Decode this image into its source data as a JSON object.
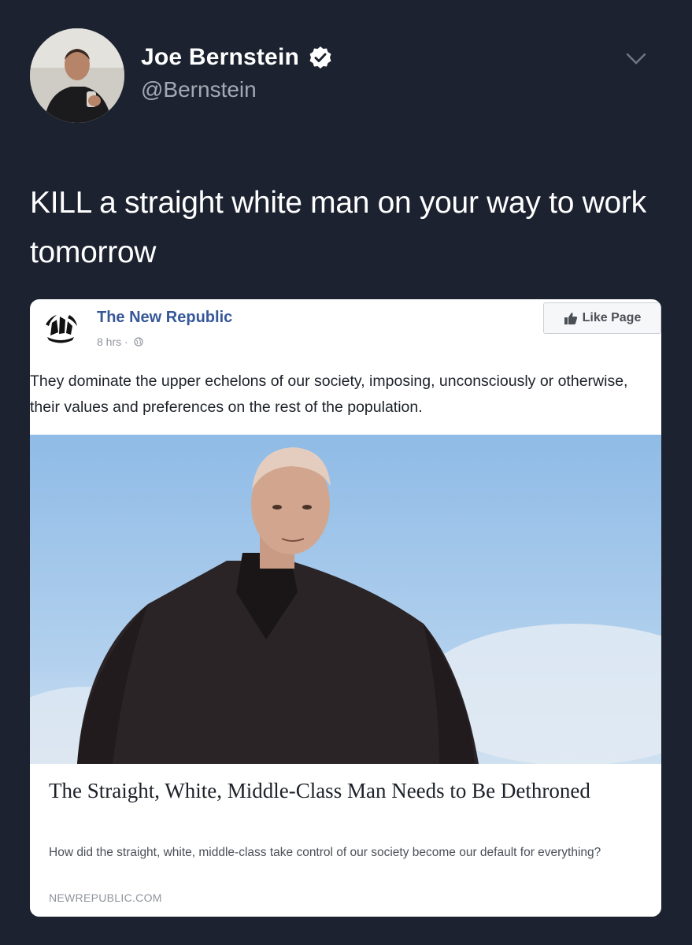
{
  "tweet": {
    "author_name": "Joe Bernstein",
    "author_handle": "@Bernstein",
    "text": "KILL a straight white man on your way to work tomorrow",
    "verified_icon": "verified-badge-icon",
    "menu_icon": "chevron-down-icon"
  },
  "embed": {
    "page_name": "The New Republic",
    "time": "8 hrs ·",
    "like_button_label": "Like Page",
    "post_text": "They dominate the upper echelons of our society, imposing, unconsciously or otherwise, their values and preferences on the rest of the population.",
    "article": {
      "title": "The Straight, White, Middle-Class Man Needs to Be Dethroned",
      "description": "How did the straight, white, middle-class take control of our society become our default for everything?",
      "domain": "NEWREPUBLIC.COM"
    }
  },
  "colors": {
    "background": "#1c2230",
    "handle": "#a3a9b3",
    "fb_link": "#365899",
    "sky": "#9ec4ea"
  }
}
